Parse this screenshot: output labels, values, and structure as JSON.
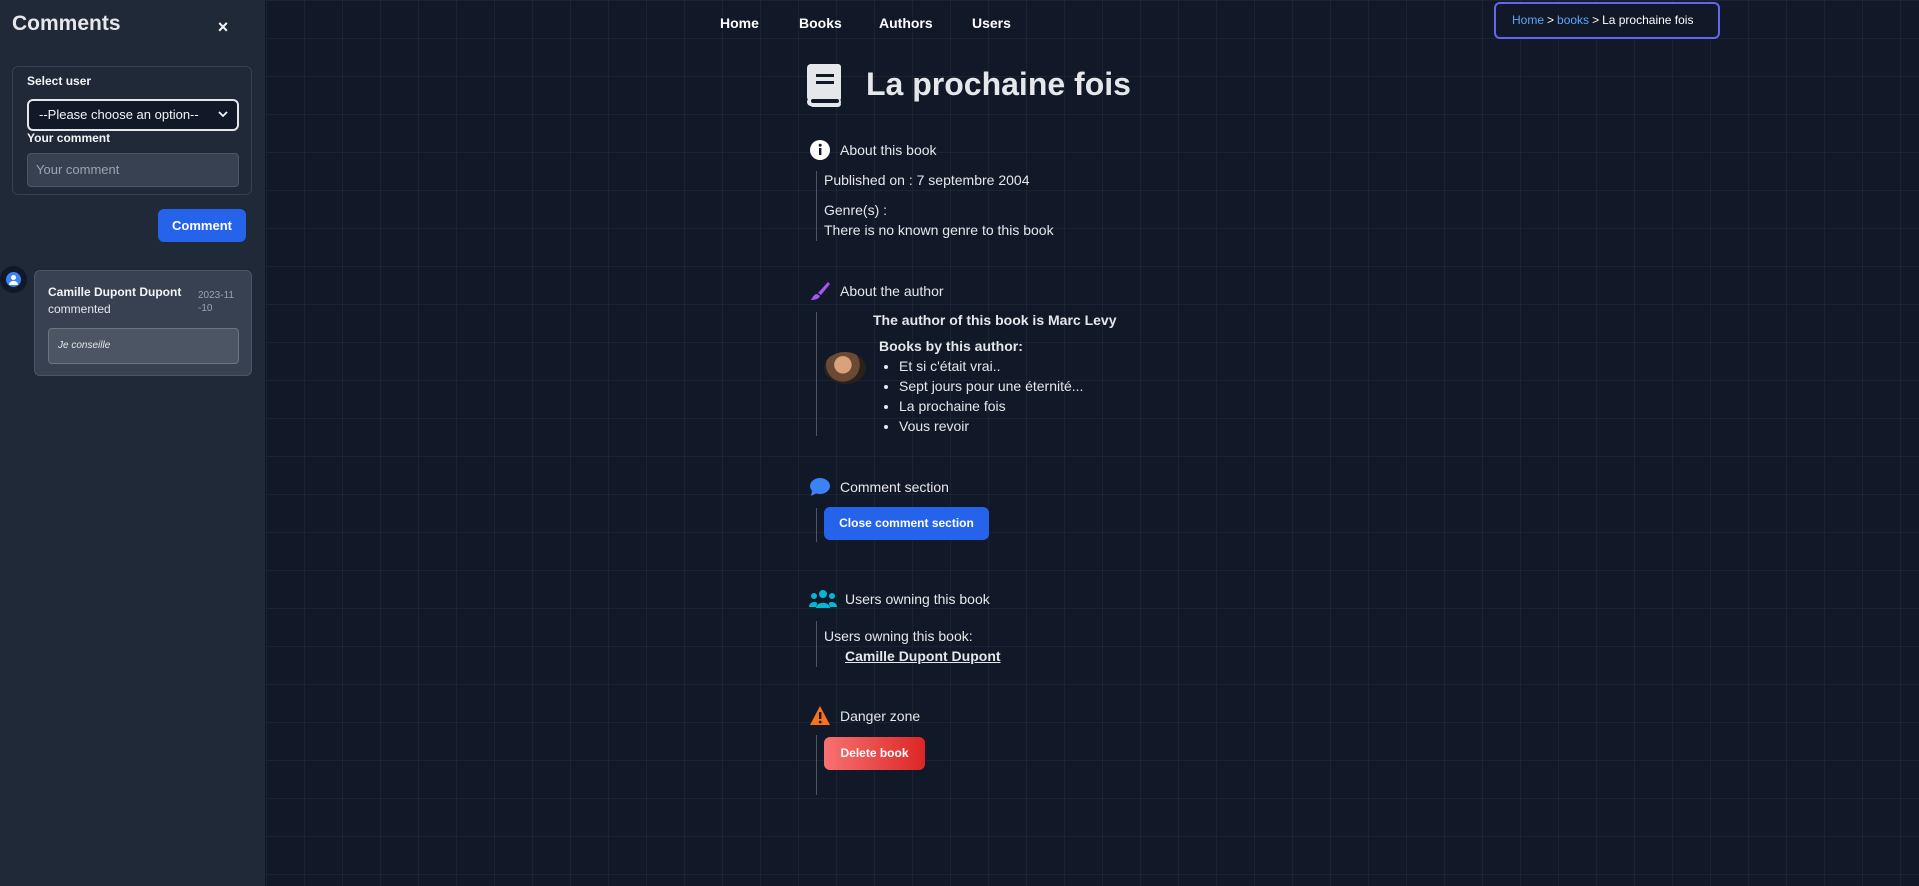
{
  "sidebar": {
    "title": "Comments",
    "close_symbol": "×",
    "select_label": "Select user",
    "select_value": "--Please choose an option--",
    "comment_label": "Your comment",
    "comment_placeholder": "Your comment",
    "submit_label": "Comment",
    "comments": [
      {
        "author": "Camille Dupont Dupont",
        "verb": "commented",
        "date": "2023-11-10",
        "text": "Je conseille"
      }
    ]
  },
  "nav": {
    "items": [
      "Home",
      "Books",
      "Authors",
      "Users"
    ]
  },
  "breadcrumb": {
    "home": "Home",
    "books": "books",
    "current": "La prochaine fois",
    "separator": ">"
  },
  "book": {
    "title": "La prochaine fois",
    "about_title": "About this book",
    "published": "Published on : 7 septembre 2004",
    "genre_label": "Genre(s) :",
    "genre_value": "There is no known genre to this book"
  },
  "author": {
    "section_title": "About the author",
    "heading": "The author of this book is Marc Levy",
    "books_label": "Books by this author:",
    "books": [
      "Et si c'était vrai..",
      "Sept jours pour une éternité...",
      "La prochaine fois",
      "Vous revoir"
    ]
  },
  "comments_section": {
    "title": "Comment section",
    "button": "Close comment section"
  },
  "owners": {
    "title": "Users owning this book",
    "label": "Users owning this book:",
    "users": [
      "Camille Dupont Dupont"
    ]
  },
  "danger": {
    "title": "Danger zone",
    "button": "Delete book"
  },
  "colors": {
    "background": "#111827",
    "sidebar": "#1f2937",
    "accent_blue": "#2563eb",
    "danger_red": "#dc2626",
    "breadcrumb_border": "#6366f1",
    "info_icon": "#ffffff",
    "author_icon": "#a855f7",
    "comment_icon": "#3b82f6",
    "users_icon": "#06b6d4",
    "warning_icon": "#f97316"
  },
  "icons": {
    "book": "book-icon",
    "info": "info-icon",
    "author": "pen-icon",
    "comment": "speech-bubble-icon",
    "users": "users-icon",
    "danger": "warning-icon",
    "close": "close-icon",
    "chevron": "chevron-down-icon",
    "avatar": "user-avatar-icon"
  }
}
